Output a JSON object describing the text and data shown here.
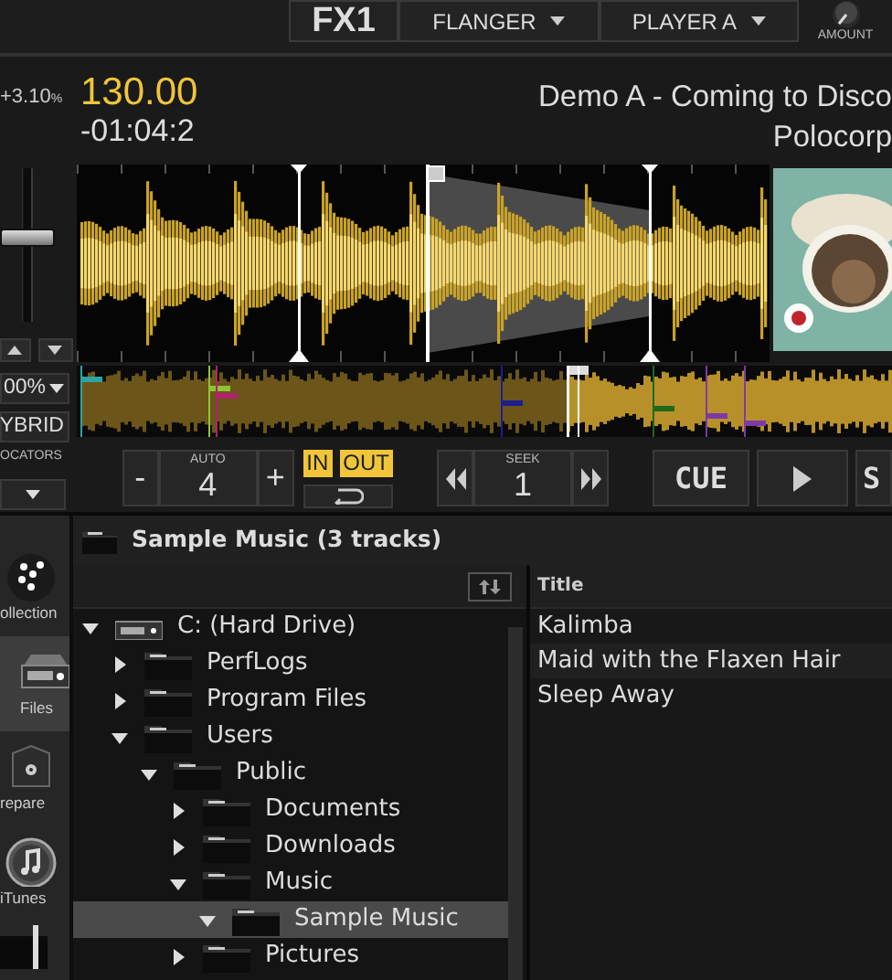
{
  "fx": {
    "unit": "FX1",
    "effect": "FLANGER",
    "target": "PLAYER A",
    "knob_label": "AMOUNT"
  },
  "deck": {
    "pitch": "+3.10",
    "pitch_unit": "%",
    "bpm": "130.00",
    "time": "-01:04:2",
    "title": "Demo A - Coming to Disco",
    "artist": "Polocorp",
    "pitch_fader": {
      "level": 0.55
    },
    "pitch_range": "00%",
    "mode": "YBRID",
    "locators_label": "OCATORS"
  },
  "loop": {
    "minus": "-",
    "label": "AUTO",
    "value": "4",
    "plus": "+",
    "in": {
      "label": "IN",
      "on": true
    },
    "out": {
      "label": "OUT",
      "on": true
    }
  },
  "seek": {
    "label": "SEEK",
    "value": "1"
  },
  "transport": {
    "cue": "CUE",
    "cut_button": "S"
  },
  "library": {
    "title": "Sample Music (3 tracks)",
    "sidebar": [
      {
        "label": "ollection",
        "kind": "collection",
        "selected": false
      },
      {
        "label": "Files",
        "kind": "files",
        "selected": true
      },
      {
        "label": "repare",
        "kind": "prepare",
        "selected": false
      },
      {
        "label": "iTunes",
        "kind": "itunes",
        "selected": false
      }
    ],
    "tree": [
      {
        "label": "C: (Hard Drive)",
        "kind": "drive",
        "expanded": true,
        "selected": false,
        "children": [
          {
            "label": "PerfLogs",
            "kind": "folder",
            "expanded": false,
            "selected": false
          },
          {
            "label": "Program Files",
            "kind": "folder",
            "expanded": false,
            "selected": false
          },
          {
            "label": "Users",
            "kind": "folder",
            "expanded": true,
            "selected": false,
            "children": [
              {
                "label": "Public",
                "kind": "folder",
                "expanded": true,
                "selected": false,
                "children": [
                  {
                    "label": "Documents",
                    "kind": "folder",
                    "expanded": false,
                    "selected": false
                  },
                  {
                    "label": "Downloads",
                    "kind": "folder",
                    "expanded": false,
                    "selected": false
                  },
                  {
                    "label": "Music",
                    "kind": "folder",
                    "expanded": true,
                    "selected": false,
                    "children": [
                      {
                        "label": "Sample Music",
                        "kind": "folder",
                        "expanded": true,
                        "selected": true
                      }
                    ]
                  },
                  {
                    "label": "Pictures",
                    "kind": "folder",
                    "expanded": false,
                    "selected": false
                  }
                ]
              }
            ]
          }
        ]
      }
    ],
    "columns": [
      "Title"
    ],
    "tracks": [
      {
        "title": "Kalimba"
      },
      {
        "title": "Maid with the Flaxen Hair"
      },
      {
        "title": "Sleep Away"
      }
    ]
  }
}
